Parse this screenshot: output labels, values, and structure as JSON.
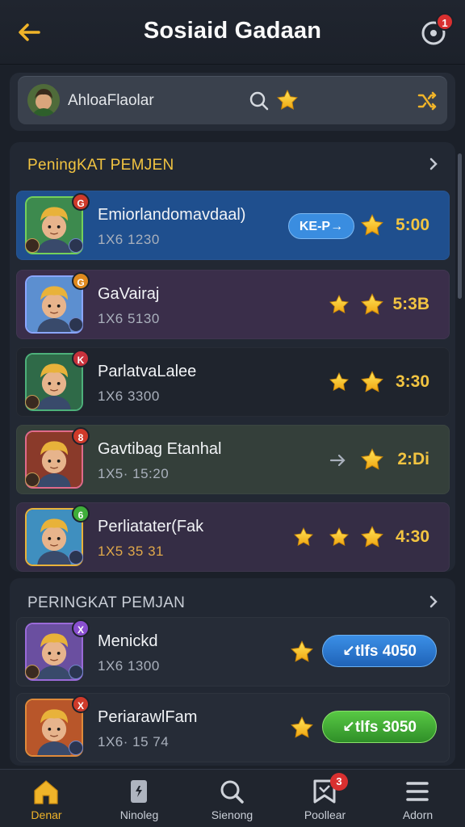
{
  "header": {
    "title": "Sosiaid Gadaan",
    "notification_count": "1"
  },
  "search": {
    "text": "AhloaFlaolar"
  },
  "section1": {
    "title": "PeningKAT PEMJEN",
    "rows": [
      {
        "name": "Emiorlandomavdaal)",
        "sub": "1X6  1230",
        "score": "5:00",
        "action": "KE-P→",
        "badge": "G"
      },
      {
        "name": "GaVairaj",
        "sub": "1X6  5130",
        "score": "5:3B",
        "badge": "G"
      },
      {
        "name": "ParlatvaLalee",
        "sub": "1X6  3300",
        "score": "3:30",
        "badge": "K"
      },
      {
        "name": "Gavtibag Etanhal",
        "sub": "1X5· 15:20",
        "score": "2:Di",
        "badge": "8"
      },
      {
        "name": "Perliatater(Fak",
        "sub": "1X5  35 31",
        "score": "4:30",
        "badge": "6"
      }
    ]
  },
  "section2": {
    "title": "PERINGKAT PEMJAN",
    "rows": [
      {
        "name": "Menickd",
        "sub": "1X6  1300",
        "button": "↙tlfs 4050",
        "badge": "X"
      },
      {
        "name": "PeriarawlFam",
        "sub": "1X6· 15 74",
        "button": "↙tlfs 3050",
        "badge": "X"
      }
    ]
  },
  "nav": {
    "items": [
      {
        "label": "Denar"
      },
      {
        "label": "Ninoleg"
      },
      {
        "label": "Sienong"
      },
      {
        "label": "Poollear",
        "badge": "3"
      },
      {
        "label": "Adorn"
      }
    ]
  },
  "colors": {
    "accent_gold": "#f2c441",
    "nav_active": "#f0b429",
    "blue_button": "#2f7fd8",
    "green_button": "#3fae3a",
    "notification_red": "#d93030"
  },
  "icons": {
    "header": [
      "back-arrow-icon",
      "notification-icon"
    ],
    "search": [
      "search-icon",
      "star-icon",
      "shuffle-icon"
    ],
    "nav": [
      "home-icon",
      "card-icon",
      "search-icon",
      "flag-icon",
      "menu-icon"
    ]
  }
}
